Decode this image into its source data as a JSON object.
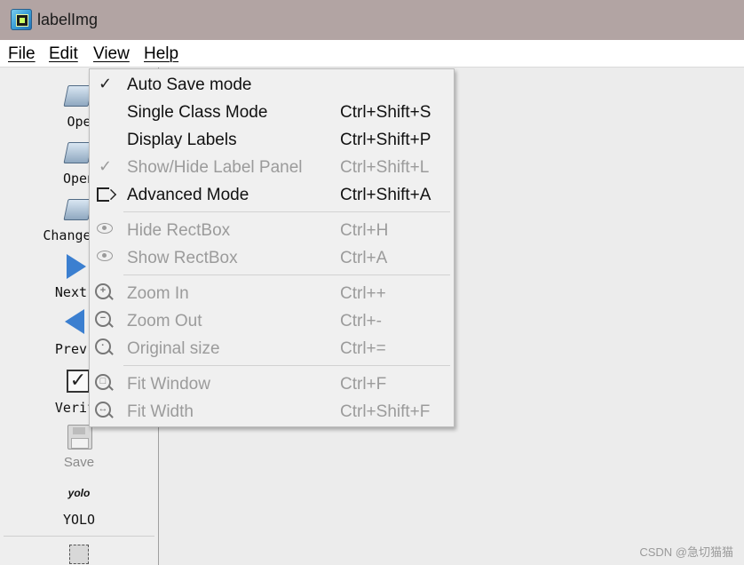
{
  "window": {
    "title": "labelImg"
  },
  "menubar": {
    "items": [
      "File",
      "Edit",
      "View",
      "Help"
    ]
  },
  "toolbar": {
    "buttons": [
      {
        "label": "Ope",
        "icon": "folder-open-icon"
      },
      {
        "label": "Open",
        "icon": "folder-open-dir-icon"
      },
      {
        "label": "Change Sa",
        "icon": "folder-change-save-icon"
      },
      {
        "label": "Next I",
        "icon": "arrow-right-icon"
      },
      {
        "label": "Prev I",
        "icon": "arrow-left-icon"
      },
      {
        "label": "Verify",
        "icon": "checkbox-icon"
      },
      {
        "label": "Save",
        "icon": "save-icon"
      },
      {
        "label": "YOLO",
        "icon": "yolo-icon",
        "icon_text": "yolo"
      }
    ]
  },
  "view_menu": {
    "items": [
      {
        "label": "Auto Save mode",
        "shortcut": "",
        "icon": "checkmark-icon",
        "checked": true,
        "enabled": true
      },
      {
        "label": "Single Class Mode",
        "shortcut": "Ctrl+Shift+S",
        "icon": "",
        "enabled": true
      },
      {
        "label": "Display Labels",
        "shortcut": "Ctrl+Shift+P",
        "icon": "",
        "enabled": true
      },
      {
        "label": "Show/Hide Label Panel",
        "shortcut": "Ctrl+Shift+L",
        "icon": "checkmark-icon",
        "checked": true,
        "enabled": false
      },
      {
        "label": "Advanced Mode",
        "shortcut": "Ctrl+Shift+A",
        "icon": "tag-icon",
        "enabled": true
      },
      {
        "label": "Hide RectBox",
        "shortcut": "Ctrl+H",
        "icon": "eye-icon",
        "enabled": false
      },
      {
        "label": "Show RectBox",
        "shortcut": "Ctrl+A",
        "icon": "eye-icon",
        "enabled": false
      },
      {
        "label": "Zoom In",
        "shortcut": "Ctrl++",
        "icon": "zoom-in-icon",
        "enabled": false
      },
      {
        "label": "Zoom Out",
        "shortcut": "Ctrl+-",
        "icon": "zoom-out-icon",
        "enabled": false
      },
      {
        "label": "Original size",
        "shortcut": "Ctrl+=",
        "icon": "zoom-original-icon",
        "enabled": false
      },
      {
        "label": "Fit Window",
        "shortcut": "Ctrl+F",
        "icon": "fit-window-icon",
        "enabled": false
      },
      {
        "label": "Fit Width",
        "shortcut": "Ctrl+Shift+F",
        "icon": "fit-width-icon",
        "enabled": false
      }
    ]
  },
  "watermark": "CSDN @急切猫猫",
  "colors": {
    "titlebar": "#b2a4a3",
    "menubar": "#ffffff",
    "menu_bg": "#f0f0f0",
    "disabled_text": "#9b9b9b",
    "accent_blue": "#3b7fd0"
  }
}
